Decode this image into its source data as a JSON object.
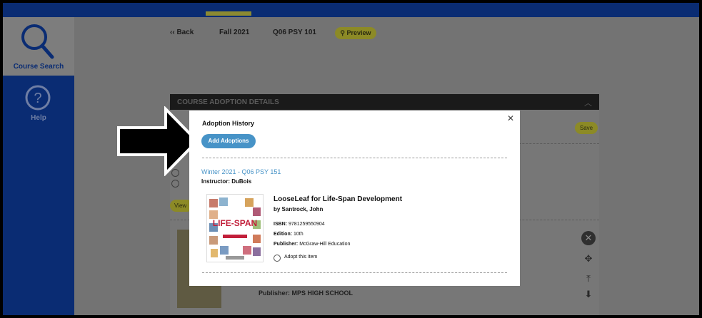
{
  "nav": {
    "course_search_label": "Course Search",
    "help_label": "Help"
  },
  "header": {
    "back_label": "Back",
    "term": "Fall 2021",
    "course": "Q06 PSY 101",
    "preview_label": "Preview"
  },
  "section": {
    "title": "COURSE ADOPTION DETAILS",
    "save_label": "Save",
    "view_label": "View",
    "publisher_label": "Publisher:",
    "publisher_value": "MPS HIGH SCHOOL"
  },
  "modal": {
    "title": "Adoption History",
    "add_button": "Add Adoptions",
    "course_line": "Winter 2021 - Q06 PSY 151",
    "instructor": "Instructor: DuBois",
    "book": {
      "title": "LooseLeaf for Life-Span Development",
      "author": "by Santrock, John",
      "isbn": "9781259550904",
      "edition": "10th",
      "publisher": "McGraw-Hill Education",
      "isbn_label": "ISBN:",
      "edition_label": "Edition:",
      "publisher_label": "Publisher:",
      "adopt_label": "Adopt this item",
      "cover_text": "LIFE-SPAN"
    }
  },
  "colors": {
    "nav_blue": "#0a2c73",
    "modal_button": "#4793c7",
    "pill_yellow": "#8c8a26"
  }
}
